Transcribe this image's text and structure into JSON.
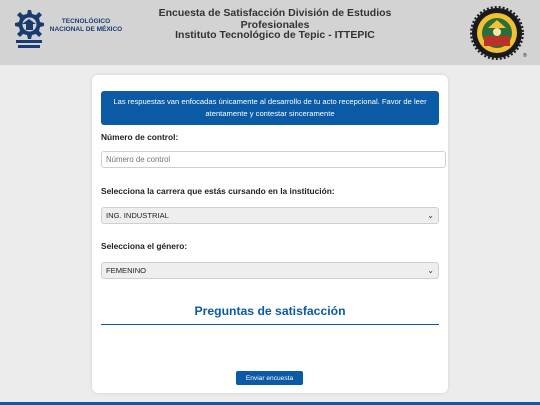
{
  "header": {
    "logo_text_line1": "TECNOLÓGICO",
    "logo_text_line2": "NACIONAL DE MÉXICO",
    "title": "Encuesta de Satisfacción División de Estudios Profesionales",
    "subtitle": "Instituto Tecnológico de Tepic - ITTEPIC"
  },
  "form": {
    "notice": "Las respuestas van enfocadas únicamente al desarrollo de tu acto recepcional. Favor de leer atentamente y contestar sinceramente",
    "control_label": "Número de control:",
    "control_placeholder": "Número de control",
    "control_value": "",
    "career_label": "Selecciona la carrera que estás cursando en la institución:",
    "career_value": "ING. INDUSTRIAL",
    "gender_label": "Selecciona el género:",
    "gender_value": "FEMENINO",
    "section_title": "Preguntas de satisfacción",
    "submit_label": "Enviar encuesta"
  },
  "colors": {
    "accent": "#0b5aa6",
    "header_bg": "#d3d3d3",
    "page_bg": "#ececec"
  },
  "icons": {
    "left_logo": "tecnm-logo-icon",
    "right_logo": "ittepic-seal-icon",
    "dropdown": "chevron-down-icon"
  }
}
